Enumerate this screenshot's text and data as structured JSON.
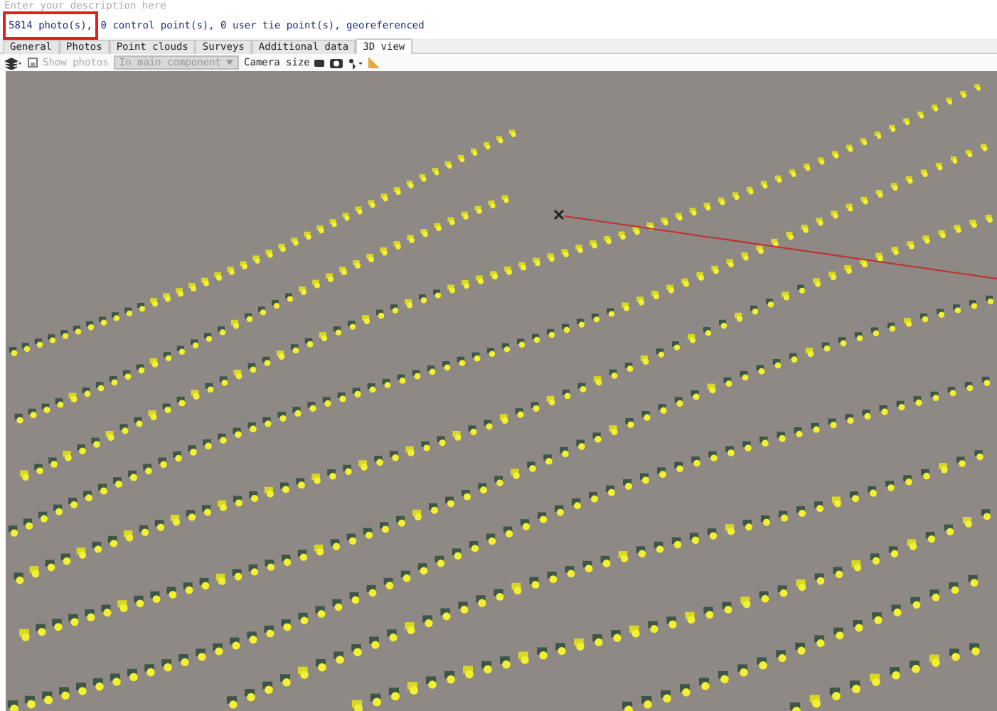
{
  "description": {
    "placeholder": "Enter your description here"
  },
  "summary": {
    "photos": "5814 photo(s),",
    "highlighted": true,
    "rest": "0 control point(s), 0 user tie point(s), georeferenced"
  },
  "tabs": [
    {
      "label": "General",
      "selected": false
    },
    {
      "label": "Photos",
      "selected": false
    },
    {
      "label": "Point clouds",
      "selected": false
    },
    {
      "label": "Surveys",
      "selected": false
    },
    {
      "label": "Additional data",
      "selected": false
    },
    {
      "label": "3D view",
      "selected": true
    }
  ],
  "toolbar": {
    "show_photos": {
      "label": "Show photos",
      "disabled": true
    },
    "component": {
      "value": "In main component",
      "disabled": true
    },
    "camera_size": "Camera size"
  }
}
